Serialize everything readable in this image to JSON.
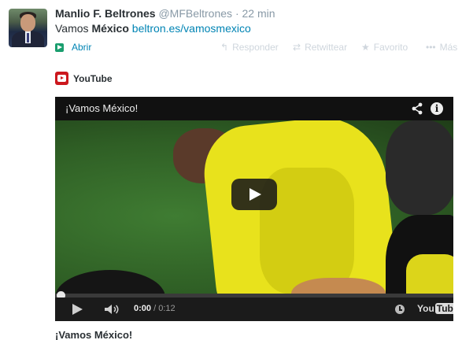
{
  "tweet": {
    "author_name": "Manlio F. Beltrones",
    "handle": "@MFBeltrones",
    "separator": "·",
    "time": "22 min",
    "text_prefix": "Vamos ",
    "text_bold": "México",
    "text_space": " ",
    "link": "beltron.es/vamosmexico"
  },
  "actions": {
    "open": "Abrir",
    "reply": "Responder",
    "retweet": "Retwittear",
    "favorite": "Favorito",
    "more": "Más"
  },
  "card": {
    "source": "YouTube",
    "caption": "¡Vamos México!"
  },
  "video": {
    "title": "¡Vamos México!",
    "current_time": "0:00",
    "duration_sep": " / ",
    "duration": "0:12",
    "wordmark_you": "You",
    "wordmark_tube": "Tube"
  },
  "colors": {
    "link": "#0084b4",
    "muted": "#8899a6",
    "youtube_red": "#cc181e"
  }
}
